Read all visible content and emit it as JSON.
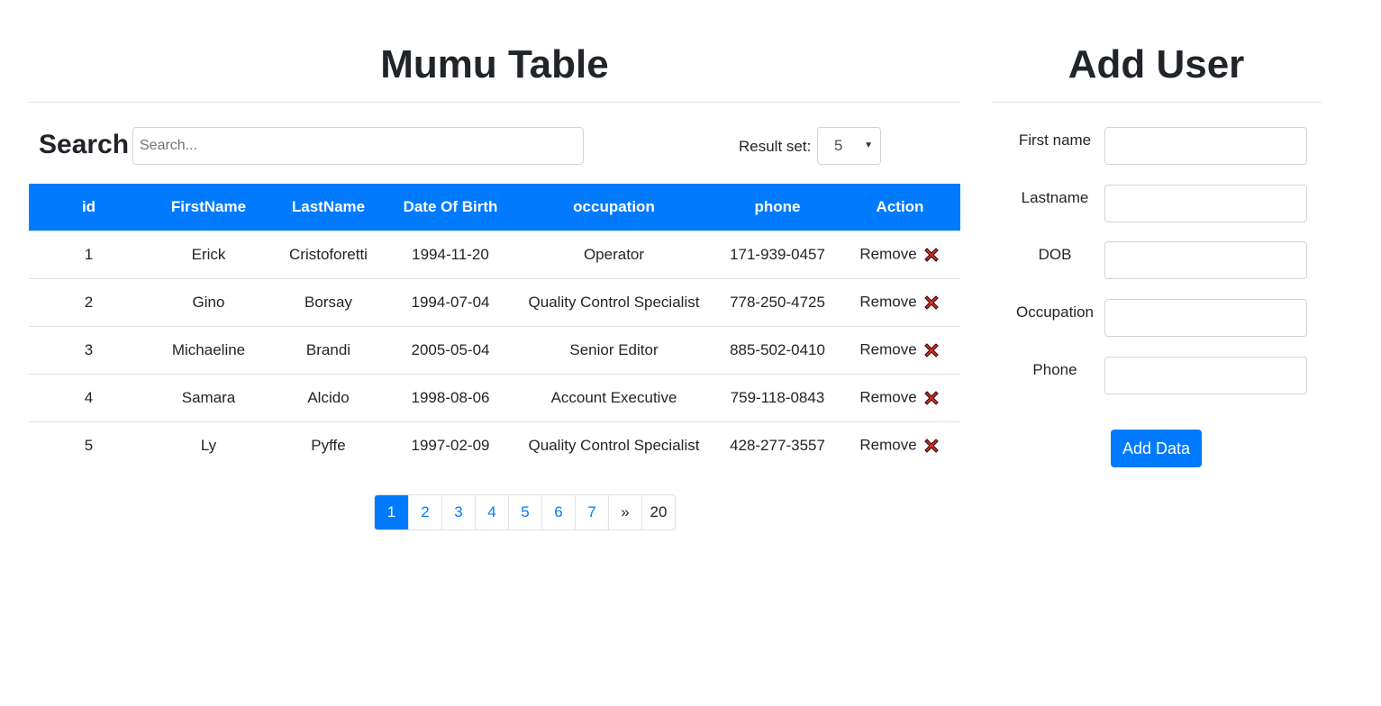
{
  "table_panel": {
    "title": "Mumu Table",
    "search_label": "Search",
    "search_placeholder": "Search...",
    "search_value": "",
    "result_set_label": "Result set:",
    "result_set_value": "5",
    "columns": [
      "id",
      "FirstName",
      "LastName",
      "Date Of Birth",
      "occupation",
      "phone",
      "Action"
    ],
    "rows": [
      {
        "id": "1",
        "first": "Erick",
        "last": "Cristoforetti",
        "dob": "1994-11-20",
        "occupation": "Operator",
        "phone": "171-939-0457",
        "action": "Remove"
      },
      {
        "id": "2",
        "first": "Gino",
        "last": "Borsay",
        "dob": "1994-07-04",
        "occupation": "Quality Control Specialist",
        "phone": "778-250-4725",
        "action": "Remove"
      },
      {
        "id": "3",
        "first": "Michaeline",
        "last": "Brandi",
        "dob": "2005-05-04",
        "occupation": "Senior Editor",
        "phone": "885-502-0410",
        "action": "Remove"
      },
      {
        "id": "4",
        "first": "Samara",
        "last": "Alcido",
        "dob": "1998-08-06",
        "occupation": "Account Executive",
        "phone": "759-118-0843",
        "action": "Remove"
      },
      {
        "id": "5",
        "first": "Ly",
        "last": "Pyffe",
        "dob": "1997-02-09",
        "occupation": "Quality Control Specialist",
        "phone": "428-277-3557",
        "action": "Remove"
      }
    ],
    "remove_icon": "close-x-icon",
    "pagination": [
      "1",
      "2",
      "3",
      "4",
      "5",
      "6",
      "7",
      "»",
      "20"
    ],
    "active_page": "1"
  },
  "add_user_panel": {
    "title": "Add User",
    "fields": [
      {
        "label": "First name",
        "value": ""
      },
      {
        "label": "Lastname",
        "value": ""
      },
      {
        "label": "DOB",
        "value": ""
      },
      {
        "label": "Occupation",
        "value": ""
      },
      {
        "label": "Phone",
        "value": ""
      }
    ],
    "submit_label": "Add Data"
  },
  "colors": {
    "accent": "#007bff",
    "text": "#212529",
    "border": "#ced4da",
    "remove_icon_fill": "#d93025"
  }
}
